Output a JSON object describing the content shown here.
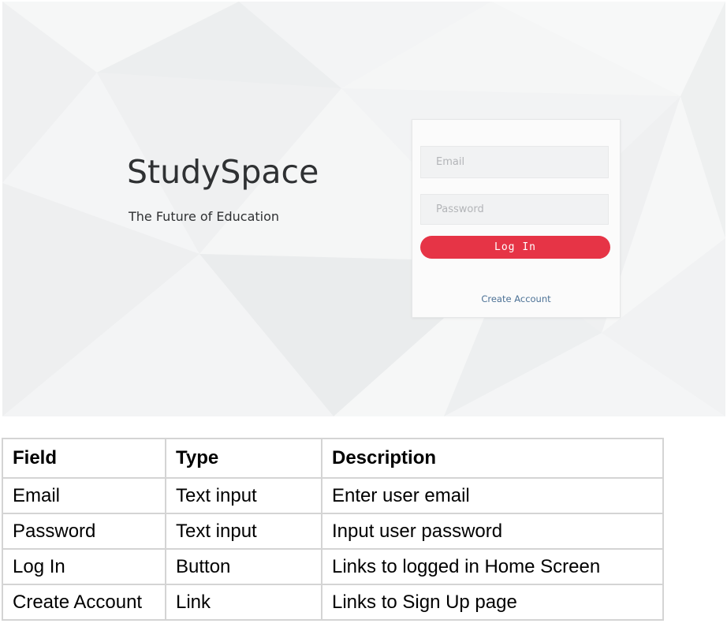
{
  "hero": {
    "title": "StudySpace",
    "subtitle": "The Future of Education"
  },
  "login_form": {
    "email_placeholder": "Email",
    "password_placeholder": "Password",
    "login_label": "Log In",
    "create_account_label": "Create Account",
    "accent_color": "#e63446",
    "link_color": "#4d7296"
  },
  "table": {
    "headers": [
      "Field",
      "Type",
      "Description"
    ],
    "rows": [
      [
        "Email",
        "Text input",
        "Enter user email"
      ],
      [
        "Password",
        "Text input",
        "Input user password"
      ],
      [
        "Log In",
        "Button",
        "Links to logged in Home Screen"
      ],
      [
        "Create Account",
        "Link",
        "Links to Sign Up page"
      ]
    ]
  }
}
